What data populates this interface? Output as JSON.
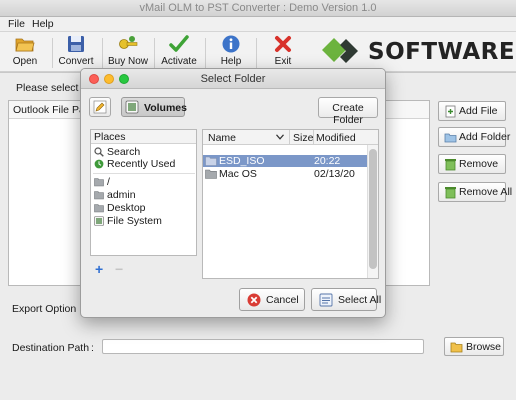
{
  "window": {
    "title": "vMail OLM to PST Converter : Demo Version 1.0"
  },
  "menu": {
    "file": "File",
    "help": "Help"
  },
  "toolbar": {
    "open": "Open",
    "convert": "Convert",
    "buy_now": "Buy Now",
    "activate": "Activate",
    "help": "Help",
    "exit": "Exit"
  },
  "logo": {
    "text": "SOFTWARE",
    "colors": {
      "green": "#6cb33e",
      "dark": "#2f3a33"
    }
  },
  "main": {
    "select_label": "Please select OL",
    "file_path_header": "Outlook File Path",
    "buttons": {
      "add_file": "Add File",
      "add_folder": "Add Folder",
      "remove": "Remove",
      "remove_all": "Remove All"
    },
    "export_label": "Export Option :",
    "destination_label": "Destination Path",
    "destination_colon": ":",
    "destination_value": "",
    "browse": "Browse"
  },
  "dialog": {
    "title": "Select Folder",
    "volumes": "Volumes",
    "create_folder": "Create Folder",
    "places_header": "Places",
    "places_top": [
      {
        "label": "Search",
        "icon": "search-icon"
      },
      {
        "label": "Recently Used",
        "icon": "recent-icon"
      }
    ],
    "places_bottom": [
      {
        "label": "/",
        "icon": "folder-icon"
      },
      {
        "label": "admin",
        "icon": "folder-icon"
      },
      {
        "label": "Desktop",
        "icon": "folder-icon"
      },
      {
        "label": "File System",
        "icon": "drive-icon"
      }
    ],
    "columns": {
      "name": "Name",
      "size": "Size",
      "modified": "Modified"
    },
    "files": [
      {
        "name": "ESD_ISO",
        "size": "",
        "modified": "20:22",
        "selected": true
      },
      {
        "name": "Mac OS",
        "size": "",
        "modified": "02/13/20",
        "selected": false
      }
    ],
    "add_symbol": "+",
    "remove_symbol": "−",
    "cancel": "Cancel",
    "select_all": "Select All"
  }
}
